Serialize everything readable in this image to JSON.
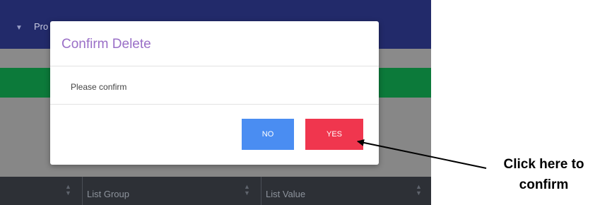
{
  "background": {
    "nav_partial_text": "Pro",
    "table_headers": [
      {
        "label": ""
      },
      {
        "label": "List Group"
      },
      {
        "label": "List Value"
      }
    ]
  },
  "modal": {
    "title": "Confirm Delete",
    "message": "Please confirm",
    "no_label": "NO",
    "yes_label": "YES"
  },
  "annotation": {
    "text": "Click here to confirm"
  },
  "colors": {
    "nav": "#222a6a",
    "green_bar": "#0c7a3a",
    "title": "#9a6fc7",
    "no_button": "#4a8df2",
    "yes_button": "#f0364e"
  }
}
